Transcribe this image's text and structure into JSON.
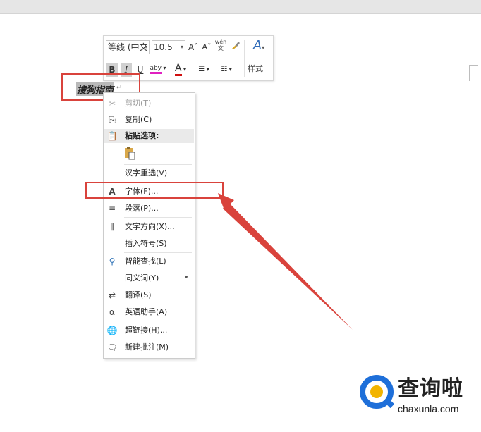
{
  "minibar": {
    "font_name": "等线 (中文",
    "font_size": "10.5",
    "grow_font": "Aˆ",
    "shrink_font": "Aˇ",
    "phonetic": "wén\n文",
    "bold": "B",
    "italic": "I",
    "underline": "U",
    "highlight": "aby",
    "font_color": "A",
    "styles_label": "样式",
    "highlight_color": "#e020c0",
    "font_color_value": "#d01010"
  },
  "document": {
    "selected_text": "搜狗指南",
    "para_mark": "↵"
  },
  "context_menu": {
    "items": [
      {
        "label": "剪切(T)",
        "icon": "scissors-icon",
        "disabled": true
      },
      {
        "label": "复制(C)",
        "icon": "copy-icon",
        "disabled": false
      },
      {
        "label": "粘贴选项:",
        "icon": "paste-icon",
        "disabled": false,
        "header": true
      },
      {
        "label": "汉字重选(V)",
        "icon": "",
        "disabled": false
      },
      {
        "label": "字体(F)...",
        "icon": "font-icon",
        "disabled": false
      },
      {
        "label": "段落(P)...",
        "icon": "paragraph-icon",
        "disabled": false
      },
      {
        "label": "文字方向(X)...",
        "icon": "text-direction-icon",
        "disabled": false
      },
      {
        "label": "插入符号(S)",
        "icon": "",
        "disabled": false
      },
      {
        "label": "智能查找(L)",
        "icon": "smart-lookup-icon",
        "disabled": false
      },
      {
        "label": "同义词(Y)",
        "icon": "",
        "disabled": false,
        "submenu": true
      },
      {
        "label": "翻译(S)",
        "icon": "translate-icon",
        "disabled": false
      },
      {
        "label": "英语助手(A)",
        "icon": "english-assistant-icon",
        "disabled": false
      },
      {
        "label": "超链接(H)...",
        "icon": "hyperlink-icon",
        "disabled": false
      },
      {
        "label": "新建批注(M)",
        "icon": "new-comment-icon",
        "disabled": false
      }
    ]
  },
  "watermark": {
    "brand": "查询啦",
    "url": "chaxunla.com"
  },
  "colors": {
    "annotation_red": "#d9433c",
    "watermark_blue": "#1e6fd9",
    "watermark_yellow": "#f2b400"
  }
}
